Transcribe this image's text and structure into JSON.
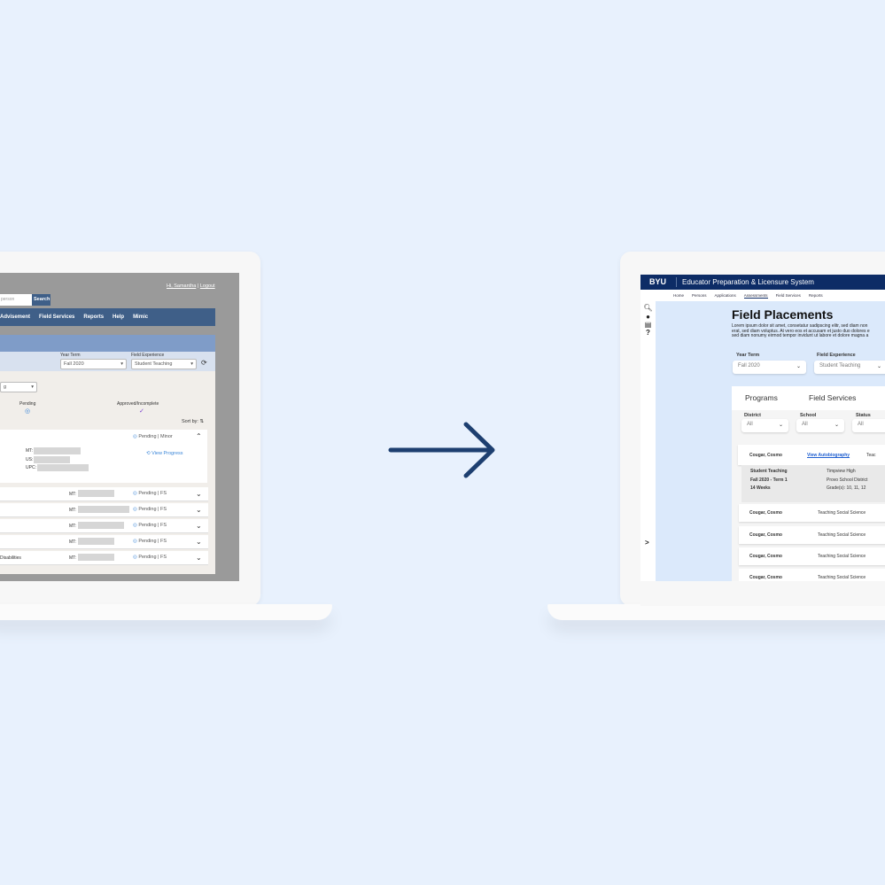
{
  "old": {
    "search_placeholder": "person",
    "search_btn": "Search",
    "user": "Hi, Samantha",
    "logout": "Logout",
    "nav": [
      "Advisement",
      "Field Services",
      "Reports",
      "Help",
      "Mimic"
    ],
    "year_term_label": "Year Term",
    "year_term": "Fall 2020",
    "fe_label": "Field Experience",
    "fe": "Student Teaching",
    "dropdown": "g",
    "pending": "Pending",
    "approved": "Approved/Incomplete",
    "sort": "Sort by:",
    "expanded_status": "Pending | Minor",
    "view_progress": "View Progress",
    "mt": "MT:",
    "us": "US:",
    "upc": "UPC:",
    "rows": [
      {
        "label": "",
        "status": "Pending | FS"
      },
      {
        "label": "",
        "status": "Pending | FS"
      },
      {
        "label": "",
        "status": "Pending | FS"
      },
      {
        "label": "",
        "status": "Pending | FS"
      },
      {
        "label": "Disabilities",
        "status": "Pending | FS"
      }
    ]
  },
  "new": {
    "logo": "BYU",
    "system": "Educator Preparation & Licensure System",
    "nav": [
      "Home",
      "Persons",
      "Applications",
      "Assessments",
      "Field Services",
      "Reports"
    ],
    "title": "Field Placements",
    "lorem": [
      "Lorem ipsum dolor sit amet, consetatur sadipscing elitr, sed diam non",
      "erat, sed diam voluptus. At vero eos et accusam et justo duo dolores e",
      "sed diam nonumy eirmod tempor invidunt ut labore et dolore magna a"
    ],
    "year_term_label": "Year Term",
    "year_term": "Fall 2020",
    "fe_label": "Field Experience",
    "fe": "Student Teaching",
    "tabs": [
      "Programs",
      "Field Services"
    ],
    "filters": [
      {
        "label": "District",
        "value": "All"
      },
      {
        "label": "School",
        "value": "All"
      },
      {
        "label": "Status",
        "value": "All"
      }
    ],
    "expanded": {
      "name": "Cougar, Cosmo",
      "link": "View Autobiography",
      "col3": "Teac",
      "details_left": [
        "Student Teaching",
        "Fall 2020 - Term 1",
        "14 Weeks"
      ],
      "details_right": [
        "Timpview High",
        "Provo School District",
        "Grade(s): 10, 11, 12"
      ]
    },
    "rows": [
      {
        "name": "Cougar, Cosmo",
        "program": "Teaching Social Science"
      },
      {
        "name": "Cougar, Cosmo",
        "program": "Teaching Social Science"
      },
      {
        "name": "Cougar, Cosmo",
        "program": "Teaching Social Science"
      },
      {
        "name": "Cougar, Cosmo",
        "program": "Teaching Social Science"
      }
    ],
    "expand": ">"
  }
}
